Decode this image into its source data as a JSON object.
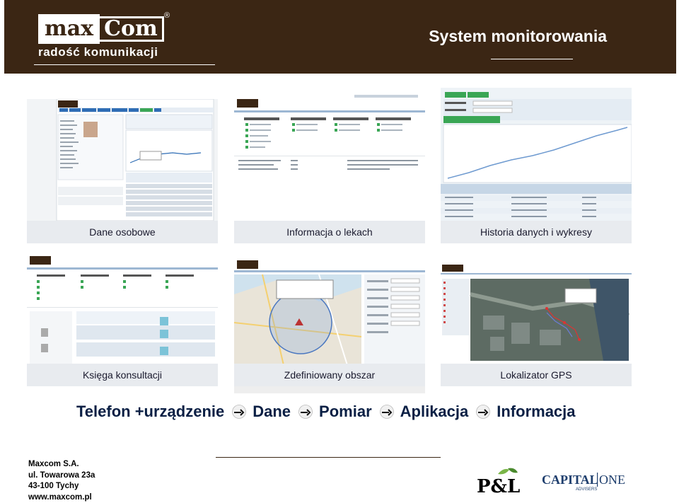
{
  "header": {
    "logo_part1": "max",
    "logo_part2": "Com",
    "logo_registered": "®",
    "tagline": "radość komunikacji",
    "title": "System monitorowania"
  },
  "tiles": [
    {
      "caption": "Dane osobowe"
    },
    {
      "caption": "Informacja o lekach"
    },
    {
      "caption": "Historia danych i wykresy"
    },
    {
      "caption": "Księga konsultacji"
    },
    {
      "caption": "Zdefiniowany obszar"
    },
    {
      "caption": "Lokalizator GPS"
    }
  ],
  "flow": {
    "steps": [
      "Telefon +urządzenie",
      "Dane",
      "Pomiar",
      "Aplikacja",
      "Informacja"
    ],
    "arrow_icon": "right-arrow-icon"
  },
  "address": {
    "company": "Maxcom S.A.",
    "street": "ul. Towarowa 23a",
    "city": "43-100 Tychy",
    "web": "www.maxcom.pl"
  },
  "partners": {
    "pl_logo_text": "P&L",
    "capital_one_text": "CAPITAL",
    "capital_one_text2": "ONE",
    "capital_one_sub": "ADVISERS"
  },
  "colors": {
    "header_bg": "#3b2614",
    "flow_text": "#0a1f44",
    "caption_bg": "#e8ebef",
    "ui_green": "#3aa655",
    "ui_blue": "#2f6db5"
  }
}
